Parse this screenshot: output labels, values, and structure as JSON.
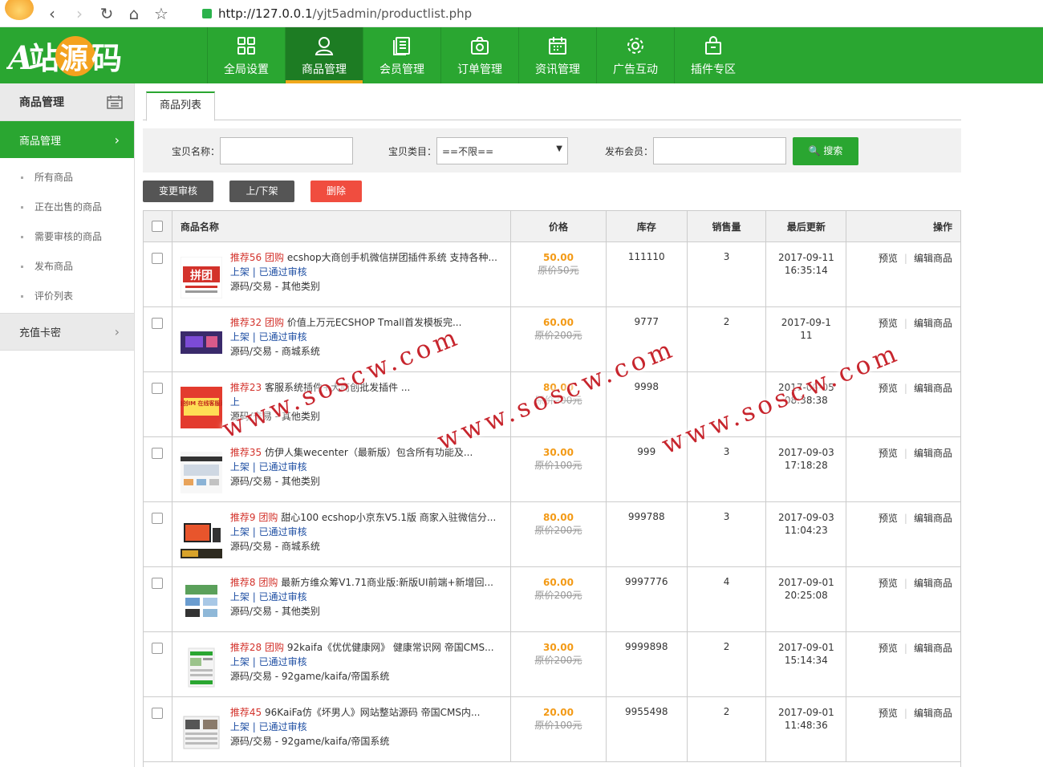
{
  "browser": {
    "url_host": "http://127.0.0.1",
    "url_path": "/yjt5admin/productlist.php"
  },
  "logo": {
    "text": "A站源码"
  },
  "topnav": [
    {
      "label": "全局设置",
      "icon": "grid-icon"
    },
    {
      "label": "商品管理",
      "icon": "user-icon",
      "active": true
    },
    {
      "label": "会员管理",
      "icon": "document-icon"
    },
    {
      "label": "订单管理",
      "icon": "camera-icon"
    },
    {
      "label": "资讯管理",
      "icon": "calendar-icon"
    },
    {
      "label": "广告互动",
      "icon": "gear-icon"
    },
    {
      "label": "插件专区",
      "icon": "bag-icon"
    }
  ],
  "sidebar": {
    "header": "商品管理",
    "active": "商品管理",
    "items": [
      "所有商品",
      "正在出售的商品",
      "需要审核的商品",
      "发布商品",
      "评价列表"
    ],
    "group2": "充值卡密"
  },
  "tab": "商品列表",
  "search": {
    "name_label": "宝贝名称：",
    "cat_label": "宝贝类目：",
    "cat_value": "==不限==",
    "member_label": "发布会员：",
    "button": "搜索"
  },
  "actions": {
    "audit": "变更审核",
    "shelf": "上/下架",
    "delete": "删除"
  },
  "table": {
    "headers": [
      "商品名称",
      "价格",
      "库存",
      "销售量",
      "最后更新",
      "操作"
    ],
    "rows": [
      {
        "rec": "推荐56 团购",
        "title": "ecshop大商创手机微信拼团插件系统 支持各种...",
        "status": "上架 | 已通过审核",
        "cat": "源码/交易 - 其他类别",
        "price": "50.00",
        "orig": "原价50元",
        "stock": "111110",
        "sales": "3",
        "date": "2017-09-11",
        "time": "16:35:14"
      },
      {
        "rec": "推荐32 团购",
        "title": "价值上万元ECSHOP           Tmall首发模板完...",
        "status": "上架 | 已通过审核",
        "cat": "源码/交易 - 商城系统",
        "price": "60.00",
        "orig": "原价200元",
        "stock": "9777",
        "sales": "2",
        "date": "2017-09-1",
        "time": "11"
      },
      {
        "rec": "推荐23",
        "title": "        客服系统插件+大商创批发插件 ...",
        "status": "上",
        "cat": "源码/交易 - 其他类别",
        "price": "80.00",
        "orig": "原价200元",
        "stock": "9998",
        "sales": "",
        "date": "2017-09-05",
        "time": "08:38:38"
      },
      {
        "rec": "推荐35",
        "title": "仿伊人集wecenter（最新版）包含所有功能及...",
        "status": "上架 | 已通过审核",
        "cat": "源码/交易 - 其他类别",
        "price": "30.00",
        "orig": "原价100元",
        "stock": "999",
        "sales": "3",
        "date": "2017-09-03",
        "time": "17:18:28"
      },
      {
        "rec": "推荐9 团购",
        "title": "甜心100 ecshop小京东V5.1版 商家入驻微信分...",
        "status": "上架 | 已通过审核",
        "cat": "源码/交易 - 商城系统",
        "price": "80.00",
        "orig": "原价200元",
        "stock": "999788",
        "sales": "3",
        "date": "2017-09-03",
        "time": "11:04:23"
      },
      {
        "rec": "推荐8 团购",
        "title": "最新方维众筹V1.71商业版:新版UI前端+新增回...",
        "status": "上架 | 已通过审核",
        "cat": "源码/交易 - 其他类别",
        "price": "60.00",
        "orig": "原价200元",
        "stock": "9997776",
        "sales": "4",
        "date": "2017-09-01",
        "time": "20:25:08"
      },
      {
        "rec": "推荐28 团购",
        "title": "92kaifa《优优健康网》 健康常识网 帝国CMS...",
        "status": "上架 | 已通过审核",
        "cat": "源码/交易 - 92game/kaifa/帝国系统",
        "price": "30.00",
        "orig": "原价200元",
        "stock": "9999898",
        "sales": "2",
        "date": "2017-09-01",
        "time": "15:14:34"
      },
      {
        "rec": "推荐45",
        "title": "96KaiFa仿《坏男人》网站整站源码 帝国CMS内...",
        "status": "上架 | 已通过审核",
        "cat": "源码/交易 - 92game/kaifa/帝国系统",
        "price": "20.00",
        "orig": "原价100元",
        "stock": "9955498",
        "sales": "2",
        "date": "2017-09-01",
        "time": "11:48:36"
      }
    ],
    "op_preview": "预览",
    "op_edit": "编辑商品"
  },
  "thumb_labels": {
    "t1": "拼团",
    "t3": "大商创IM 在线客服系统"
  },
  "watermark": "www.soscw.com",
  "colors": {
    "brand_green": "#2aa631",
    "accent_orange": "#f0a81c",
    "price": "#f39a16",
    "danger": "#f04d3f"
  }
}
